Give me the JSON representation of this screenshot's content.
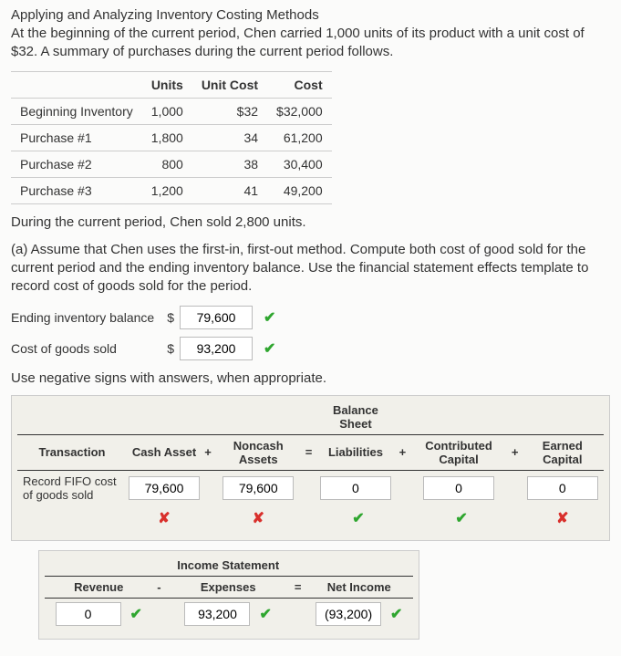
{
  "title": "Applying and Analyzing Inventory Costing Methods",
  "intro": "At the beginning of the current period, Chen carried 1,000 units of its product with a unit cost of $32. A summary of purchases during the current period follows.",
  "purch": {
    "headers": [
      "Units",
      "Unit Cost",
      "Cost"
    ],
    "rows": [
      {
        "label": "Beginning Inventory",
        "units": "1,000",
        "unit_cost": "$32",
        "cost": "$32,000"
      },
      {
        "label": "Purchase #1",
        "units": "1,800",
        "unit_cost": "34",
        "cost": "61,200"
      },
      {
        "label": "Purchase #2",
        "units": "800",
        "unit_cost": "38",
        "cost": "30,400"
      },
      {
        "label": "Purchase #3",
        "units": "1,200",
        "unit_cost": "41",
        "cost": "49,200"
      }
    ]
  },
  "sold_text": "During the current period, Chen sold 2,800 units.",
  "part_a": "(a) Assume that Chen uses the first-in, first-out method. Compute both cost of good sold for the current period and the ending inventory balance. Use the financial statement effects template to record cost of goods sold for the period.",
  "ending_label": "Ending inventory balance",
  "ending_value": "79,600",
  "cogs_label": "Cost of goods sold",
  "cogs_value": "93,200",
  "currency": "$",
  "note": "Use negative signs with answers, when appropriate.",
  "bs": {
    "title": "Balance Sheet",
    "headers": {
      "transaction": "Transaction",
      "cash": "Cash Asset",
      "noncash": "Noncash Assets",
      "liab": "Liabilities",
      "contrib": "Contributed Capital",
      "earned": "Earned Capital"
    },
    "ops": {
      "plus": "+",
      "eq": "="
    },
    "row": {
      "label": "Record FIFO cost of goods sold",
      "cash": "79,600",
      "noncash": "79,600",
      "liab": "0",
      "contrib": "0",
      "earned": "0"
    },
    "marks": {
      "cash": "✘",
      "noncash": "✘",
      "liab": "✔",
      "contrib": "✔",
      "earned": "✘"
    }
  },
  "is": {
    "title": "Income Statement",
    "headers": {
      "rev": "Revenue",
      "exp": "Expenses",
      "net": "Net Income"
    },
    "ops": {
      "minus": "-",
      "eq": "="
    },
    "row": {
      "rev": "0",
      "exp": "93,200",
      "net": "(93,200)"
    },
    "marks": {
      "rev": "✔",
      "exp": "✔",
      "net": "✔"
    }
  },
  "icons": {
    "check": "✔",
    "cross": "✘"
  }
}
